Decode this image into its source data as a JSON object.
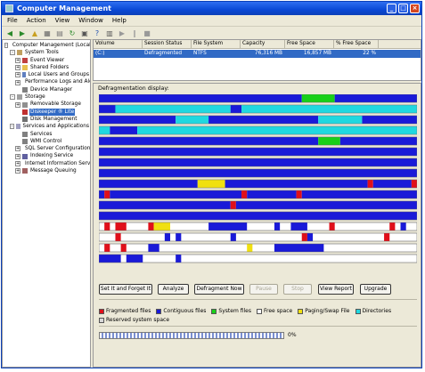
{
  "window": {
    "title": "Computer Management"
  },
  "menu": [
    "File",
    "Action",
    "View",
    "Window",
    "Help"
  ],
  "toolbar_icons": [
    "back-icon",
    "forward-icon",
    "up-icon",
    "show-hide-tree-icon",
    "properties-icon",
    "refresh-icon",
    "export-icon",
    "help-icon",
    "view-icon",
    "play-icon",
    "pause-icon",
    "stop-icon"
  ],
  "tree": [
    {
      "label": "Computer Management (Local)",
      "level": 0,
      "exp": "-",
      "icon": "computer-icon",
      "color": "#7f9fbf"
    },
    {
      "label": "System Tools",
      "level": 1,
      "exp": "-",
      "icon": "tools-icon",
      "color": "#c0a060"
    },
    {
      "label": "Event Viewer",
      "level": 2,
      "exp": "+",
      "icon": "event-viewer-icon",
      "color": "#c04040"
    },
    {
      "label": "Shared Folders",
      "level": 2,
      "exp": "+",
      "icon": "folder-icon",
      "color": "#e8c050"
    },
    {
      "label": "Local Users and Groups",
      "level": 2,
      "exp": "+",
      "icon": "users-icon",
      "color": "#6080c0"
    },
    {
      "label": "Performance Logs and Alerts",
      "level": 2,
      "exp": "+",
      "icon": "performance-icon",
      "color": "#40a040"
    },
    {
      "label": "Device Manager",
      "level": 2,
      "exp": "",
      "icon": "device-manager-icon",
      "color": "#808080"
    },
    {
      "label": "Storage",
      "level": 1,
      "exp": "-",
      "icon": "storage-icon",
      "color": "#a0a0a0"
    },
    {
      "label": "Removable Storage",
      "level": 2,
      "exp": "+",
      "icon": "removable-storage-icon",
      "color": "#909090"
    },
    {
      "label": "Diskeeper ® Lite",
      "level": 2,
      "exp": "",
      "icon": "diskeeper-icon",
      "color": "#c03030",
      "selected": true
    },
    {
      "label": "Disk Management",
      "level": 2,
      "exp": "",
      "icon": "disk-management-icon",
      "color": "#707070"
    },
    {
      "label": "Services and Applications",
      "level": 1,
      "exp": "-",
      "icon": "services-apps-icon",
      "color": "#a0a0c0"
    },
    {
      "label": "Services",
      "level": 2,
      "exp": "",
      "icon": "services-icon",
      "color": "#808080"
    },
    {
      "label": "WMI Control",
      "level": 2,
      "exp": "",
      "icon": "wmi-icon",
      "color": "#808080"
    },
    {
      "label": "SQL Server Configuration Ma",
      "level": 2,
      "exp": "+",
      "icon": "sql-server-icon",
      "color": "#c08040"
    },
    {
      "label": "Indexing Service",
      "level": 2,
      "exp": "+",
      "icon": "indexing-icon",
      "color": "#6060a0"
    },
    {
      "label": "Internet Information Service",
      "level": 2,
      "exp": "+",
      "icon": "iis-icon",
      "color": "#60a0c0"
    },
    {
      "label": "Message Queuing",
      "level": 2,
      "exp": "+",
      "icon": "message-queuing-icon",
      "color": "#a06060"
    }
  ],
  "volumes": {
    "headers": [
      "Volume",
      "Session Status",
      "File System",
      "Capacity",
      "Free Space",
      "% Free Space"
    ],
    "rows": [
      [
        "(C:)",
        "Defragmented",
        "NTFS",
        "76,316 MB",
        "16,857 MB",
        "22 %"
      ]
    ]
  },
  "display_label": "Defragmentation display:",
  "buttons": {
    "set_it": "Set It and Forget It",
    "analyze": "Analyze",
    "defragment": "Defragment Now",
    "pause": "Pause",
    "stop": "Stop",
    "view_report": "View Report",
    "upgrade": "Upgrade"
  },
  "legend": {
    "fragmented": "Fragmented files",
    "contiguous": "Contiguous files",
    "system": "System files",
    "free": "Free space",
    "paging": "Paging/Swap File",
    "directories": "Directories",
    "reserved": "Reserved system space"
  },
  "colors": {
    "fragmented": "#e0101a",
    "contiguous": "#1a1ad8",
    "system": "#18d018",
    "free": "#ffffff",
    "paging": "#f0e010",
    "directories": "#20d8e0",
    "reserved": "#d8d8d8"
  },
  "progress": {
    "fraction": 0.0,
    "text": "0%"
  },
  "defrag_map": [
    "BBBBBBBBBBBBBBBBBBBBBBBBBBBBBBBBBBBBBSSSSSSBBBBBBBBBBBBBBB",
    "BBBDDDDDDDDDDDDDDDDDDDDDBBDDDDDDDDDDDDDDDDDDDDDDDDDDDDDDDD",
    "BBBBBBBBBBBBBBDDDDDDBBBBBBBBBBBBBBBBBBBBDDDDDDDDBBBBBBBBBB",
    "DDBBBBBDDDDDDDDDDDDDDDDDDDDDDDDDDDDDDDDDDDDDDDDDDDDDDDDDDD",
    "BBBBBBBBBBBBBBBBBBBBBBBBBBBBBBBBBBBBBBBBSSSSBBBBBBBBBBBBBB",
    "BBBBBBBBBBBBBBBBBBBBBBBBBBBBBBBBBBBBBBBBBBBBBBBBBBBBBBBBBB",
    "BBBBBBBBBBBBBBBBBBBBBBBBBBBBBBBBBBBBBBBBBBBBBBBBBBBBBBBBBB",
    "BBBBBBBBBBBBBBBBBBBBBBBBBBBBBBBBBBBBBBBBBBBBBBBBBBBBBBBBBB",
    "BBBBBBBBBBBBBBBBBBPPPPPBBBBBBBBBBBBBBBBBBBBBBBBBBFBBBBBBBF",
    "BFBBBBBBBBBBBBBBBBBBBBBBBBFBBBBBBBBBFBBBBBBBBBBBBBBBBBBBBB",
    "BBBBBBBBBBBBBBBBBBBBBBBBFBBBBBBBBBBBBBBBBBBBBBBBBBBBBBBBBB",
    "BBBBBBBBBBBBBBBBBBBBBBBBBBBBBBBBBBBBBBBBBBBBBBBBBBBBBBBBBB",
    "WFWFFWWWWFPPPWWWWWWWBBBBBBBWWWWWBWWBBBWWWWFWWWWWWWWWWFWBWW",
    "WWWFWWWWWWWWBWBWWWWWWWWWBWWWWWWWWWWWWFBWWWWWWWWWWWWWFWWWWW",
    "WFWWFWWWWBBWWWWWWWWWWWWWWWWPWWWWBBBBBBBBBWWWWWWWWWWWWWWWWW",
    "BBBBWBBBWWWWWWBWWWWWWWWWWWWWWWWWWWWWWWWWWWWWWWWWWWWWWWWWWW"
  ]
}
